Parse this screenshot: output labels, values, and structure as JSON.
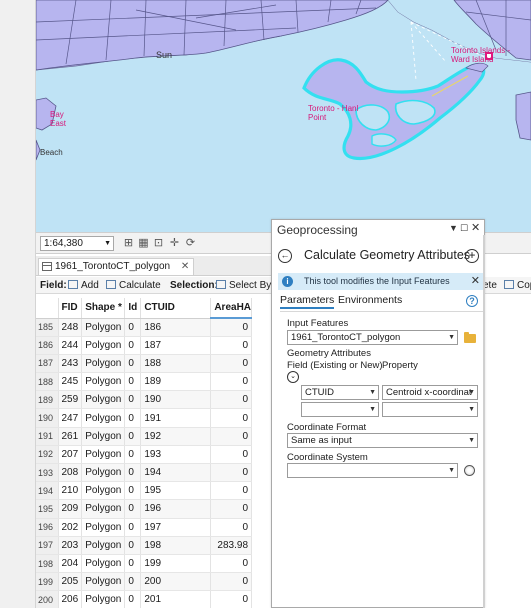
{
  "map": {
    "labels": {
      "sunnyside": "Sun",
      "toronto_islands": "Toronto Islands - Ward Island",
      "toronto_hanlan": "Toronto - Hanl Point",
      "bay": "Bay East",
      "beach": "Beach"
    },
    "colors": {
      "water": "#bfe3f5",
      "land": "#b7b5ef",
      "selection": "#33e0f0"
    }
  },
  "map_status": {
    "scale": "1:64,380",
    "icons": [
      "grid-icon",
      "table-icon",
      "select-icon",
      "crosshair-icon",
      "refresh-icon"
    ]
  },
  "table_tab": {
    "label": "1961_TorontoCT_polygon",
    "close": "✕"
  },
  "toolbar": {
    "field_label": "Field:",
    "add_label": "Add",
    "calculate_label": "Calculate",
    "selection_label": "Selection:",
    "select_by_label": "Select By A",
    "delete_label": "ete",
    "copy_label": "Cop"
  },
  "table": {
    "columns": [
      "",
      "FID",
      "Shape *",
      "Id",
      "CTUID",
      "AreaHA"
    ],
    "rows": [
      [
        "185",
        "248",
        "Polygon",
        "0",
        "186",
        "0"
      ],
      [
        "186",
        "244",
        "Polygon",
        "0",
        "187",
        "0"
      ],
      [
        "187",
        "243",
        "Polygon",
        "0",
        "188",
        "0"
      ],
      [
        "188",
        "245",
        "Polygon",
        "0",
        "189",
        "0"
      ],
      [
        "189",
        "259",
        "Polygon",
        "0",
        "190",
        "0"
      ],
      [
        "190",
        "247",
        "Polygon",
        "0",
        "191",
        "0"
      ],
      [
        "191",
        "261",
        "Polygon",
        "0",
        "192",
        "0"
      ],
      [
        "192",
        "207",
        "Polygon",
        "0",
        "193",
        "0"
      ],
      [
        "193",
        "208",
        "Polygon",
        "0",
        "194",
        "0"
      ],
      [
        "194",
        "210",
        "Polygon",
        "0",
        "195",
        "0"
      ],
      [
        "195",
        "209",
        "Polygon",
        "0",
        "196",
        "0"
      ],
      [
        "196",
        "202",
        "Polygon",
        "0",
        "197",
        "0"
      ],
      [
        "197",
        "203",
        "Polygon",
        "0",
        "198",
        "283.98"
      ],
      [
        "198",
        "204",
        "Polygon",
        "0",
        "199",
        "0"
      ],
      [
        "199",
        "205",
        "Polygon",
        "0",
        "200",
        "0"
      ],
      [
        "200",
        "206",
        "Polygon",
        "0",
        "201",
        "0"
      ]
    ]
  },
  "geoprocessing": {
    "title": "Geoprocessing",
    "tool_name": "Calculate Geometry Attributes",
    "info_message": "This tool modifies the Input Features",
    "tabs": [
      "Parameters",
      "Environments"
    ],
    "input_features_label": "Input Features",
    "input_features_value": "1961_TorontoCT_polygon",
    "geometry_attributes_label": "Geometry Attributes",
    "field_header": "Field (Existing or New)",
    "property_header": "Property",
    "rows": [
      {
        "field": "CTUID",
        "property": "Centroid x-coordinat"
      },
      {
        "field": "",
        "property": ""
      }
    ],
    "coordinate_format_label": "Coordinate Format",
    "coordinate_format_value": "Same as input",
    "coordinate_system_label": "Coordinate System",
    "coordinate_system_value": ""
  }
}
